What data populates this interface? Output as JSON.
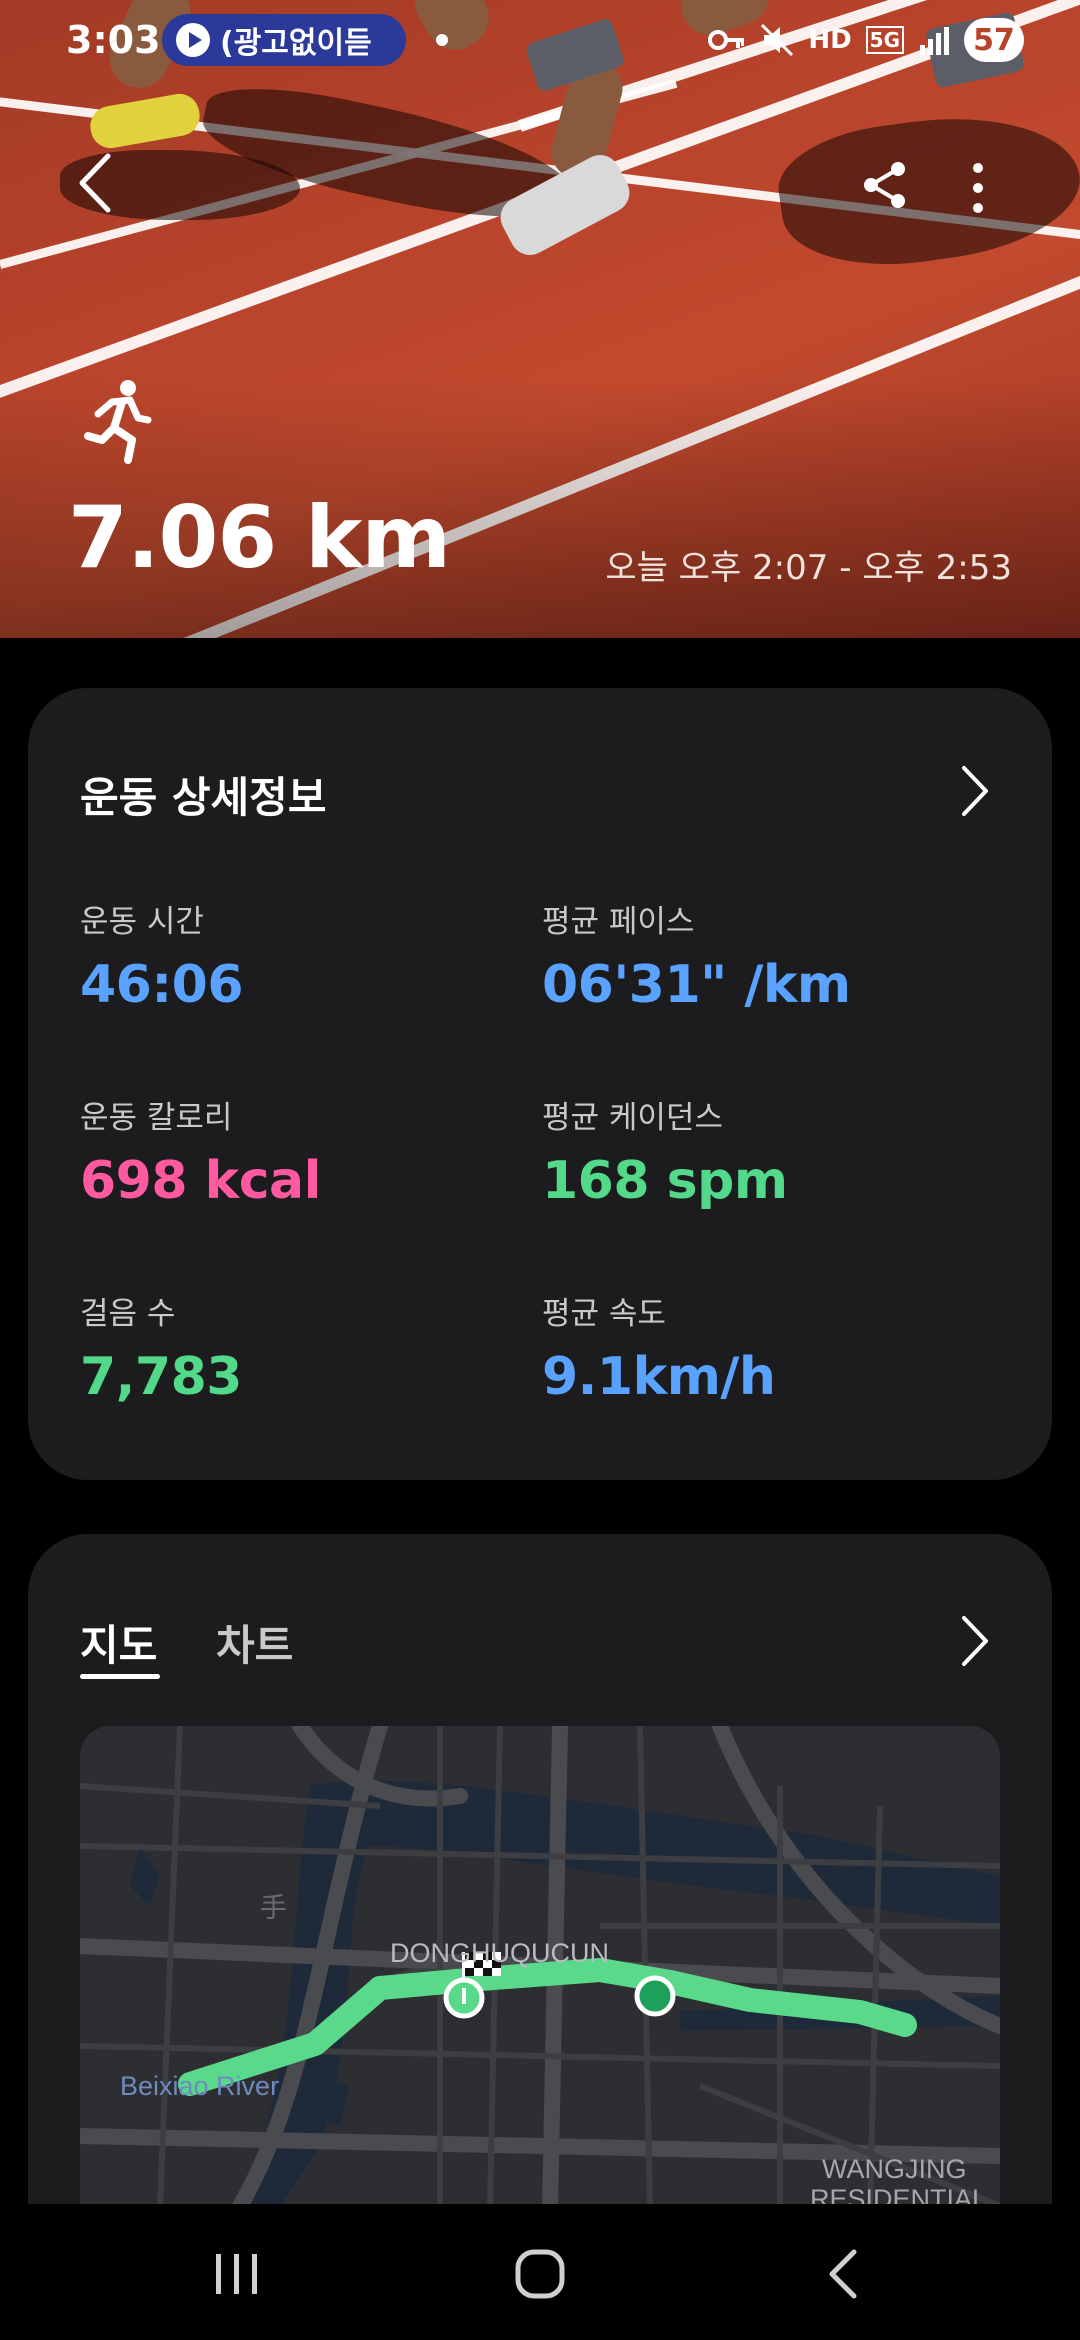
{
  "status_bar": {
    "time": "3:03",
    "media_text": "(광고없이듣",
    "network": "HD",
    "signal": "5G",
    "battery": "57"
  },
  "hero": {
    "distance": "7.06 km",
    "time_range": "오늘 오후 2:07 - 오후 2:53",
    "activity_icon": "running-icon"
  },
  "details": {
    "title": "운동 상세정보",
    "metrics": [
      {
        "label": "운동 시간",
        "value": "46:06",
        "color": "#5aa2ff"
      },
      {
        "label": "평균 페이스",
        "value": "06'31\" /km",
        "color": "#5aa2ff"
      },
      {
        "label": "운동 칼로리",
        "value": "698 kcal",
        "color": "#ff5aa0"
      },
      {
        "label": "평균 케이던스",
        "value": "168 spm",
        "color": "#52d98a"
      },
      {
        "label": "걸음 수",
        "value": "7,783",
        "color": "#52d98a"
      },
      {
        "label": "평균 속도",
        "value": "9.1km/h",
        "color": "#5aa2ff"
      }
    ]
  },
  "map_section": {
    "tabs": [
      "지도",
      "차트"
    ],
    "selected_tab": "지도",
    "labels": {
      "district": "DONGHUQUCUN",
      "river": "Beixiao River",
      "area": "WANGJING",
      "area2": "RESIDENTIAL",
      "hanzi": "手"
    },
    "route_color": "#5ad98a"
  },
  "nav": {
    "icons": [
      "recent-apps-icon",
      "home-icon",
      "back-icon"
    ]
  }
}
